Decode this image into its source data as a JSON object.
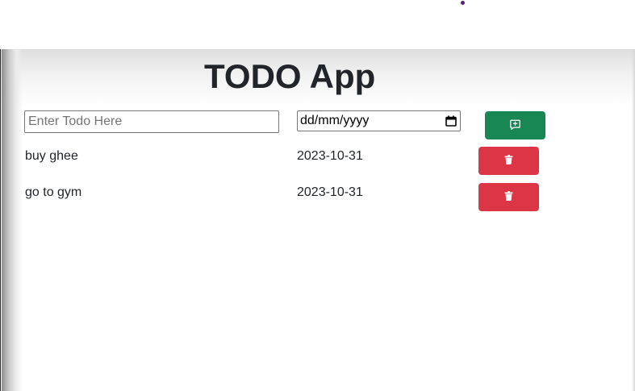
{
  "app": {
    "title": "TODO App"
  },
  "new_todo": {
    "name_placeholder": "Enter Todo Here",
    "name_value": "",
    "date_placeholder": "dd/mm/yyyy",
    "add_button_icon": "add-comment-icon",
    "add_button_color": "#198754"
  },
  "todos": [
    {
      "name": "buy ghee",
      "date": "2023-10-31",
      "delete_icon": "trash-icon"
    },
    {
      "name": "go to gym",
      "date": "2023-10-31",
      "delete_icon": "trash-icon"
    }
  ],
  "colors": {
    "title_text": "#212529",
    "delete_button": "#dc3545",
    "cursor_dot": "#5a1c80"
  }
}
